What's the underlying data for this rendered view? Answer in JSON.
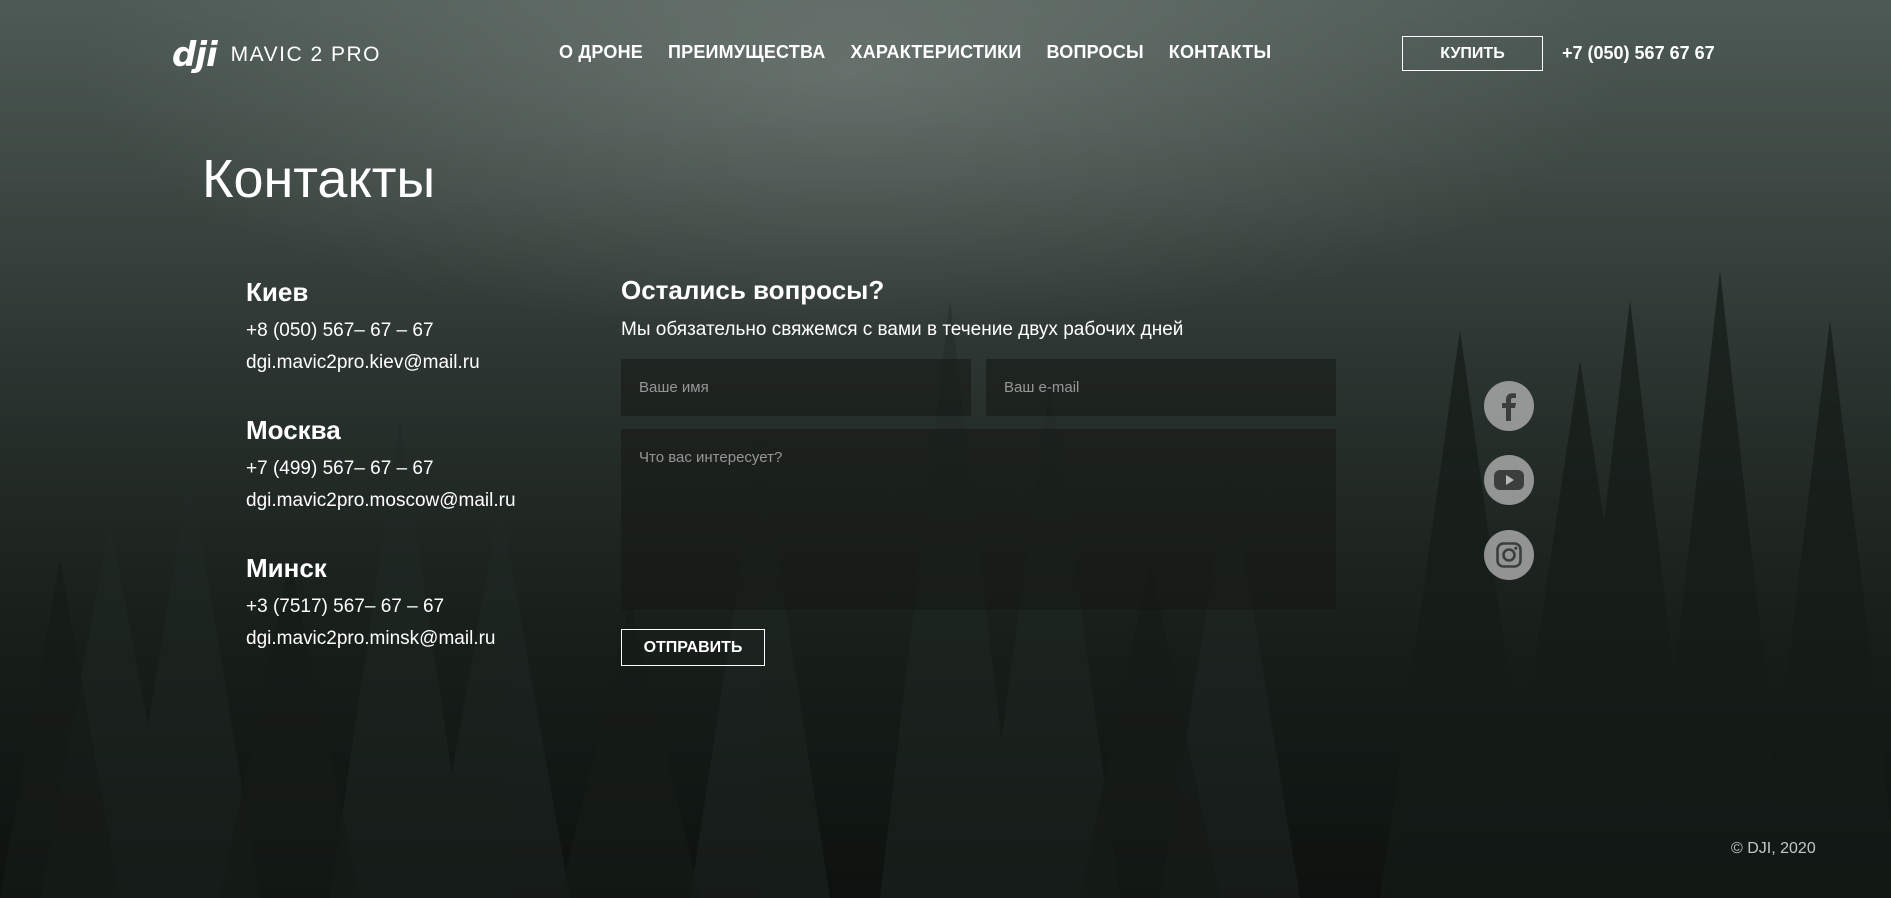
{
  "header": {
    "logo_mark": "dji",
    "logo_text": "MAVIC 2 PRO",
    "nav": [
      "О ДРОНЕ",
      "ПРЕИМУЩЕСТВА",
      "ХАРАКТЕРИСТИКИ",
      "ВОПРОСЫ",
      "КОНТАКТЫ"
    ],
    "buy_label": "КУПИТЬ",
    "phone": "+7 (050) 567 67 67"
  },
  "page_title": "Контакты",
  "contacts": [
    {
      "city": "Киев",
      "phone": "+8 (050) 567– 67 – 67",
      "email": "dgi.mavic2pro.kiev@mail.ru"
    },
    {
      "city": "Москва",
      "phone": "+7 (499) 567– 67 – 67",
      "email": "dgi.mavic2pro.moscow@mail.ru"
    },
    {
      "city": "Минск",
      "phone": "+3 (7517) 567– 67 – 67",
      "email": "dgi.mavic2pro.minsk@mail.ru"
    }
  ],
  "form": {
    "title": "Остались вопросы?",
    "subtitle": "Мы обязательно свяжемся с вами в течение двух рабочих дней",
    "name_placeholder": "Ваше имя",
    "email_placeholder": "Ваш e-mail",
    "message_placeholder": "Что вас интересует?",
    "submit_label": "ОТПРАВИТЬ"
  },
  "social": [
    "facebook-icon",
    "youtube-icon",
    "instagram-icon"
  ],
  "footer": {
    "copyright": "© DJI, 2020"
  }
}
